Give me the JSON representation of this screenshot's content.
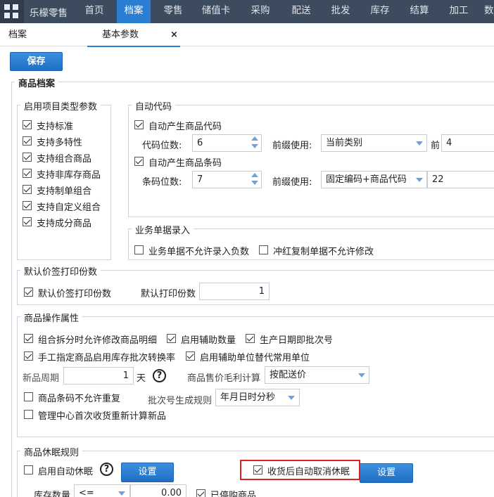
{
  "nav": {
    "brand": "乐檬零售",
    "items": [
      "首页",
      "档案",
      "零售",
      "储值卡",
      "采购",
      "配送",
      "批发",
      "库存",
      "结算",
      "加工",
      "数"
    ],
    "active_index": 1,
    "colors": {
      "bar": "#3c4b5e",
      "active": "#2a7fd4"
    }
  },
  "tabs": [
    {
      "label": "档案",
      "active": false
    },
    {
      "label": "基本参数",
      "active": true,
      "close": "×"
    }
  ],
  "toolbar": {
    "save_label": "保存"
  },
  "section_title": "商品档案",
  "enable_types": {
    "legend": "启用项目类型参数",
    "items": [
      {
        "label": "支持标准",
        "checked": true
      },
      {
        "label": "支持多特性",
        "checked": true
      },
      {
        "label": "支持组合商品",
        "checked": true
      },
      {
        "label": "支持非库存商品",
        "checked": true
      },
      {
        "label": "支持制单组合",
        "checked": true
      },
      {
        "label": "支持自定义组合",
        "checked": true
      },
      {
        "label": "支持成分商品",
        "checked": true
      }
    ]
  },
  "auto_code": {
    "legend": "自动代码",
    "gen_code_label": "自动产生商品代码",
    "gen_code_checked": true,
    "code_digits_label": "代码位数:",
    "code_digits_value": "6",
    "prefix_label_1": "前缀使用:",
    "prefix_value_1": "当前类别",
    "front_label": "前",
    "front_value": "4",
    "gen_barcode_label": "自动产生商品条码",
    "gen_barcode_checked": true,
    "barcode_digits_label": "条码位数:",
    "barcode_digits_value": "7",
    "prefix_label_2": "前缀使用:",
    "prefix_value_2": "固定编码+商品代码",
    "prefix_extra_value": "22"
  },
  "business_entry": {
    "legend": "业务单据录入",
    "no_negative_label": "业务单据不允许录入负数",
    "no_negative_checked": false,
    "no_modify_label": "冲红复制单据不允许修改",
    "no_modify_checked": false
  },
  "price_tag": {
    "legend": "默认价签打印份数",
    "enable_label": "默认价签打印份数",
    "enable_checked": true,
    "copies_label": "默认打印份数",
    "copies_value": "1"
  },
  "goods_ops": {
    "legend": "商品操作属性",
    "split_label": "组合拆分时允许修改商品明细",
    "split_checked": true,
    "aux_qty_label": "启用辅助数量",
    "aux_qty_checked": true,
    "batch_label": "生产日期即批次号",
    "batch_checked": true,
    "manual_label": "手工指定商品启用库存批次转换率",
    "manual_checked": true,
    "aux_unit_label": "启用辅助单位替代常用单位",
    "aux_unit_checked": true,
    "new_period_label": "新品周期",
    "new_period_value": "1",
    "day_unit": "天",
    "help": "?",
    "margin_label": "商品售价毛利计算",
    "margin_value": "按配送价",
    "barcode_dup_label": "商品条码不允许重复",
    "barcode_dup_checked": false,
    "batch_rule_label": "批次号生成规则",
    "batch_rule_value": "年月日时分秒",
    "recalc_label": "管理中心首次收货重新计算新品",
    "recalc_checked": false
  },
  "dormancy": {
    "legend": "商品休眠规则",
    "auto_label": "启用自动休眠",
    "auto_checked": false,
    "help": "?",
    "settings_label_1": "设置",
    "cancel_label": "收货后自动取消休眠",
    "cancel_checked": true,
    "settings_label_2": "设置",
    "stock_qty_label": "库存数量",
    "op_value": "<=",
    "qty_value": "0.00",
    "stopped_label": "已停购商品",
    "stopped_checked": true
  }
}
